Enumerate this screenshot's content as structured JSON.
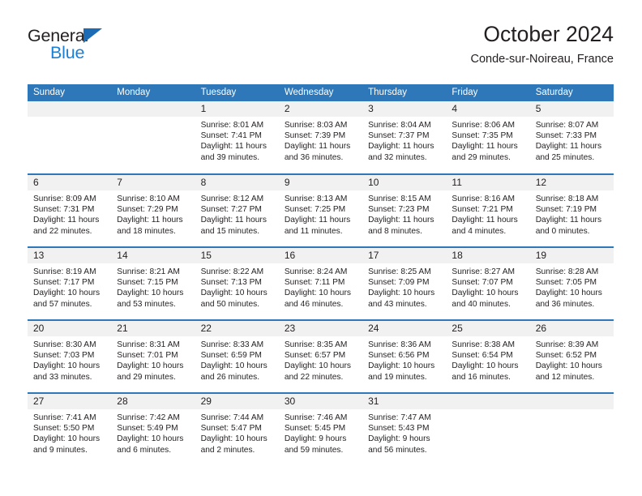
{
  "brand": {
    "name_top": "General",
    "name_bottom": "Blue",
    "triangle_color": "#1c6cb5",
    "blue_text_color": "#1c7fd4"
  },
  "header": {
    "title": "October 2024",
    "subtitle": "Conde-sur-Noireau, France"
  },
  "colors": {
    "header_blue": "#2e77b8",
    "daynum_band": "#f1f1f1",
    "text": "#231f20"
  },
  "day_headers": [
    "Sunday",
    "Monday",
    "Tuesday",
    "Wednesday",
    "Thursday",
    "Friday",
    "Saturday"
  ],
  "labels": {
    "sunrise_prefix": "Sunrise: ",
    "sunset_prefix": "Sunset: ",
    "daylight_prefix": "Daylight: "
  },
  "weeks": [
    [
      {
        "day": "",
        "empty": true
      },
      {
        "day": "",
        "empty": true
      },
      {
        "day": "1",
        "sunrise": "Sunrise: 8:01 AM",
        "sunset": "Sunset: 7:41 PM",
        "daylight": "Daylight: 11 hours and 39 minutes."
      },
      {
        "day": "2",
        "sunrise": "Sunrise: 8:03 AM",
        "sunset": "Sunset: 7:39 PM",
        "daylight": "Daylight: 11 hours and 36 minutes."
      },
      {
        "day": "3",
        "sunrise": "Sunrise: 8:04 AM",
        "sunset": "Sunset: 7:37 PM",
        "daylight": "Daylight: 11 hours and 32 minutes."
      },
      {
        "day": "4",
        "sunrise": "Sunrise: 8:06 AM",
        "sunset": "Sunset: 7:35 PM",
        "daylight": "Daylight: 11 hours and 29 minutes."
      },
      {
        "day": "5",
        "sunrise": "Sunrise: 8:07 AM",
        "sunset": "Sunset: 7:33 PM",
        "daylight": "Daylight: 11 hours and 25 minutes."
      }
    ],
    [
      {
        "day": "6",
        "sunrise": "Sunrise: 8:09 AM",
        "sunset": "Sunset: 7:31 PM",
        "daylight": "Daylight: 11 hours and 22 minutes."
      },
      {
        "day": "7",
        "sunrise": "Sunrise: 8:10 AM",
        "sunset": "Sunset: 7:29 PM",
        "daylight": "Daylight: 11 hours and 18 minutes."
      },
      {
        "day": "8",
        "sunrise": "Sunrise: 8:12 AM",
        "sunset": "Sunset: 7:27 PM",
        "daylight": "Daylight: 11 hours and 15 minutes."
      },
      {
        "day": "9",
        "sunrise": "Sunrise: 8:13 AM",
        "sunset": "Sunset: 7:25 PM",
        "daylight": "Daylight: 11 hours and 11 minutes."
      },
      {
        "day": "10",
        "sunrise": "Sunrise: 8:15 AM",
        "sunset": "Sunset: 7:23 PM",
        "daylight": "Daylight: 11 hours and 8 minutes."
      },
      {
        "day": "11",
        "sunrise": "Sunrise: 8:16 AM",
        "sunset": "Sunset: 7:21 PM",
        "daylight": "Daylight: 11 hours and 4 minutes."
      },
      {
        "day": "12",
        "sunrise": "Sunrise: 8:18 AM",
        "sunset": "Sunset: 7:19 PM",
        "daylight": "Daylight: 11 hours and 0 minutes."
      }
    ],
    [
      {
        "day": "13",
        "sunrise": "Sunrise: 8:19 AM",
        "sunset": "Sunset: 7:17 PM",
        "daylight": "Daylight: 10 hours and 57 minutes."
      },
      {
        "day": "14",
        "sunrise": "Sunrise: 8:21 AM",
        "sunset": "Sunset: 7:15 PM",
        "daylight": "Daylight: 10 hours and 53 minutes."
      },
      {
        "day": "15",
        "sunrise": "Sunrise: 8:22 AM",
        "sunset": "Sunset: 7:13 PM",
        "daylight": "Daylight: 10 hours and 50 minutes."
      },
      {
        "day": "16",
        "sunrise": "Sunrise: 8:24 AM",
        "sunset": "Sunset: 7:11 PM",
        "daylight": "Daylight: 10 hours and 46 minutes."
      },
      {
        "day": "17",
        "sunrise": "Sunrise: 8:25 AM",
        "sunset": "Sunset: 7:09 PM",
        "daylight": "Daylight: 10 hours and 43 minutes."
      },
      {
        "day": "18",
        "sunrise": "Sunrise: 8:27 AM",
        "sunset": "Sunset: 7:07 PM",
        "daylight": "Daylight: 10 hours and 40 minutes."
      },
      {
        "day": "19",
        "sunrise": "Sunrise: 8:28 AM",
        "sunset": "Sunset: 7:05 PM",
        "daylight": "Daylight: 10 hours and 36 minutes."
      }
    ],
    [
      {
        "day": "20",
        "sunrise": "Sunrise: 8:30 AM",
        "sunset": "Sunset: 7:03 PM",
        "daylight": "Daylight: 10 hours and 33 minutes."
      },
      {
        "day": "21",
        "sunrise": "Sunrise: 8:31 AM",
        "sunset": "Sunset: 7:01 PM",
        "daylight": "Daylight: 10 hours and 29 minutes."
      },
      {
        "day": "22",
        "sunrise": "Sunrise: 8:33 AM",
        "sunset": "Sunset: 6:59 PM",
        "daylight": "Daylight: 10 hours and 26 minutes."
      },
      {
        "day": "23",
        "sunrise": "Sunrise: 8:35 AM",
        "sunset": "Sunset: 6:57 PM",
        "daylight": "Daylight: 10 hours and 22 minutes."
      },
      {
        "day": "24",
        "sunrise": "Sunrise: 8:36 AM",
        "sunset": "Sunset: 6:56 PM",
        "daylight": "Daylight: 10 hours and 19 minutes."
      },
      {
        "day": "25",
        "sunrise": "Sunrise: 8:38 AM",
        "sunset": "Sunset: 6:54 PM",
        "daylight": "Daylight: 10 hours and 16 minutes."
      },
      {
        "day": "26",
        "sunrise": "Sunrise: 8:39 AM",
        "sunset": "Sunset: 6:52 PM",
        "daylight": "Daylight: 10 hours and 12 minutes."
      }
    ],
    [
      {
        "day": "27",
        "sunrise": "Sunrise: 7:41 AM",
        "sunset": "Sunset: 5:50 PM",
        "daylight": "Daylight: 10 hours and 9 minutes."
      },
      {
        "day": "28",
        "sunrise": "Sunrise: 7:42 AM",
        "sunset": "Sunset: 5:49 PM",
        "daylight": "Daylight: 10 hours and 6 minutes."
      },
      {
        "day": "29",
        "sunrise": "Sunrise: 7:44 AM",
        "sunset": "Sunset: 5:47 PM",
        "daylight": "Daylight: 10 hours and 2 minutes."
      },
      {
        "day": "30",
        "sunrise": "Sunrise: 7:46 AM",
        "sunset": "Sunset: 5:45 PM",
        "daylight": "Daylight: 9 hours and 59 minutes."
      },
      {
        "day": "31",
        "sunrise": "Sunrise: 7:47 AM",
        "sunset": "Sunset: 5:43 PM",
        "daylight": "Daylight: 9 hours and 56 minutes."
      },
      {
        "day": "",
        "empty": true
      },
      {
        "day": "",
        "empty": true
      }
    ]
  ]
}
